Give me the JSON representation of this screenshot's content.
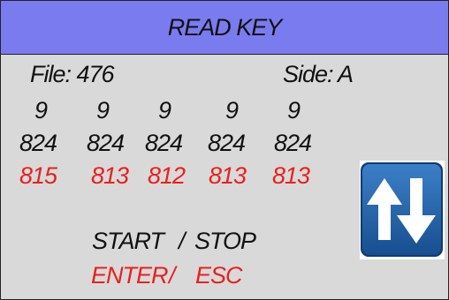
{
  "title": "READ KEY",
  "file": {
    "label": "File: 476"
  },
  "side": {
    "label": "Side: A"
  },
  "rows": {
    "row1": [
      "9",
      "9",
      "9",
      "9",
      "9"
    ],
    "row2": [
      "824",
      "824",
      "824",
      "824",
      "824"
    ],
    "row3": [
      "815",
      "813",
      "812",
      "813",
      "813"
    ]
  },
  "controls": {
    "start": "START",
    "stop_sep": "/",
    "stop": "STOP",
    "enter": "ENTER",
    "esc_sep": "/",
    "esc": "ESC"
  },
  "icons": {
    "toggle": "up-down-arrows-icon"
  },
  "colors": {
    "title_bar": "#7b7bf0",
    "panel": "#d9d9d9",
    "text": "#111111",
    "alert": "#e8211f",
    "icon_blue": "#1f5fa5"
  }
}
